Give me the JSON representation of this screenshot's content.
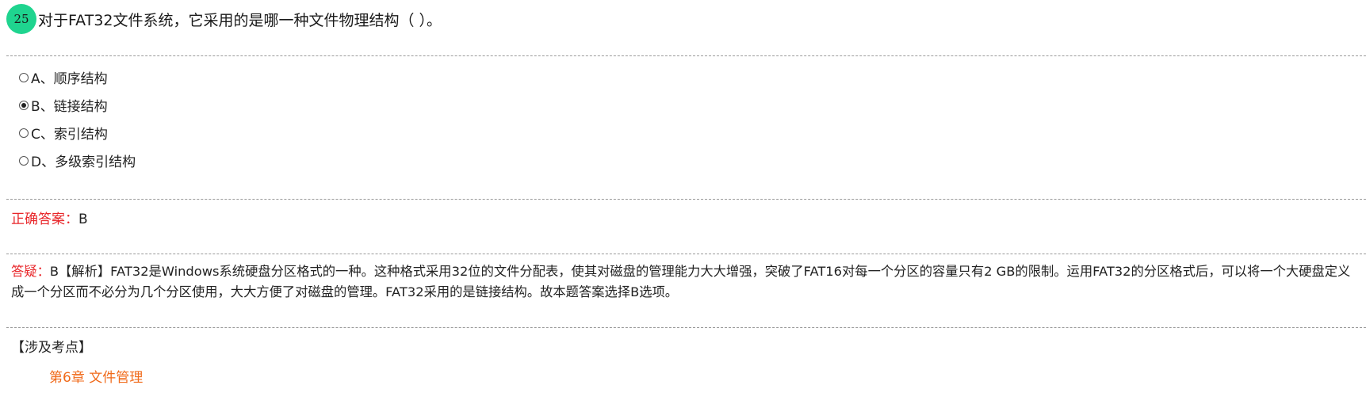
{
  "question": {
    "number": "25",
    "text": "对于FAT32文件系统，它采用的是哪一种文件物理结构（  ）。"
  },
  "options": [
    {
      "label": "A、顺序结构",
      "selected": false
    },
    {
      "label": "B、链接结构",
      "selected": true
    },
    {
      "label": "C、索引结构",
      "selected": false
    },
    {
      "label": "D、多级索引结构",
      "selected": false
    }
  ],
  "answer": {
    "label": "正确答案：",
    "value": "B"
  },
  "analysis": {
    "label": "答疑：",
    "text": "B【解析】FAT32是Windows系统硬盘分区格式的一种。这种格式采用32位的文件分配表，使其对磁盘的管理能力大大增强，突破了FAT16对每一个分区的容量只有2 GB的限制。运用FAT32的分区格式后，可以将一个大硬盘定义成一个分区而不必分为几个分区使用，大大方便了对磁盘的管理。FAT32采用的是链接结构。故本题答案选择B选项。"
  },
  "topics": {
    "title": "【涉及考点】",
    "items": [
      "第6章 文件管理"
    ]
  },
  "colors": {
    "badge": "#1fd48f",
    "highlight_red": "#e8262a",
    "topic_link": "#f06a1a",
    "divider": "#9a9a9a"
  }
}
